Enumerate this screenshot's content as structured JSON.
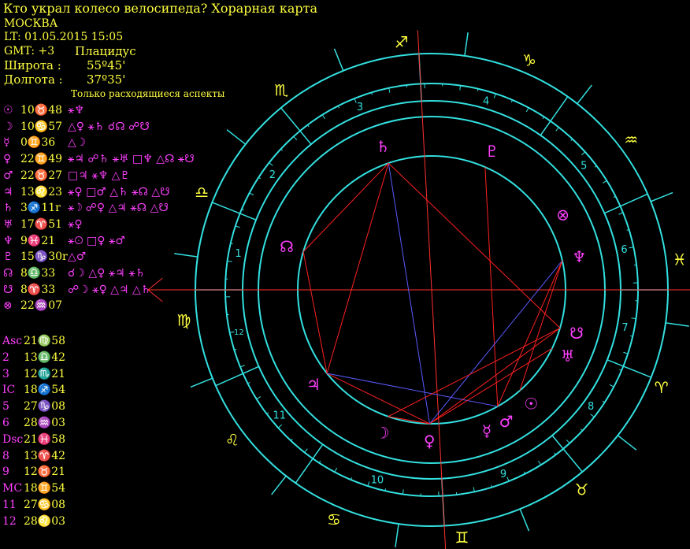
{
  "header": {
    "title": "Кто украл колесо велосипеда? Хорарная карта",
    "city": "МОСКВА",
    "lt": "LT: 01.05.2015  15:05",
    "gmt": "GMT: +3",
    "house_system": "Плацидус",
    "lat_label": "Широта :",
    "lat_value": "55º45'",
    "lon_label": "Долгота :",
    "lon_value": "37º35'",
    "aspect_note": "Только расходящиеся аспекты"
  },
  "planets": [
    {
      "glyph": "☉",
      "pos": "10♉48",
      "aspects": "⚹♆"
    },
    {
      "glyph": "☽",
      "pos": "10♋57",
      "aspects": "△♀ ⚹♄ ☌☊ ☍☋"
    },
    {
      "glyph": "☿",
      "pos": "0♊36",
      "aspects": "△☽"
    },
    {
      "glyph": "♀",
      "pos": "22♊49",
      "aspects": "⚹♃ ☍♄ ⚹♅ □♆ △☊ ⚹☋"
    },
    {
      "glyph": "♂",
      "pos": "22♉27",
      "aspects": "□♃ ⚹♆ △♇"
    },
    {
      "glyph": "♃",
      "pos": "13♌23",
      "aspects": "⚹♀ □♂ △♄ ⚹☊ △☋"
    },
    {
      "glyph": "♄",
      "pos": "3♐11r",
      "aspects": "⚹☽ ☍♀ △♃ ⚹☊ △☋"
    },
    {
      "glyph": "♅",
      "pos": "17♈51",
      "aspects": "⚹♀"
    },
    {
      "glyph": "♆",
      "pos": "9♓21",
      "aspects": "⚹☉ □♀ ⚹♂"
    },
    {
      "glyph": "♇",
      "pos": "15♑30r",
      "aspects": "△♂"
    },
    {
      "glyph": "☊",
      "pos": "8♎33",
      "aspects": "☌☽ △♀ ⚹♃ ⚹♄"
    },
    {
      "glyph": "☋",
      "pos": "8♈33",
      "aspects": "☍☽ ⚹♀ △♃ △♄"
    },
    {
      "glyph": "⊗",
      "pos": "22♒07",
      "aspects": ""
    }
  ],
  "houses": [
    {
      "label": "Asc",
      "pos": "21♍58"
    },
    {
      "label": "2",
      "pos": "13♎42"
    },
    {
      "label": "3",
      "pos": "12♏21"
    },
    {
      "label": "IC",
      "pos": "18♐54"
    },
    {
      "label": "5",
      "pos": "27♑08"
    },
    {
      "label": "6",
      "pos": "28♒03"
    },
    {
      "label": "Dsc",
      "pos": "21♓58"
    },
    {
      "label": "8",
      "pos": "13♈42"
    },
    {
      "label": "9",
      "pos": "12♉21"
    },
    {
      "label": "MC",
      "pos": "18♊54"
    },
    {
      "label": "11",
      "pos": "27♋08"
    },
    {
      "label": "12",
      "pos": "28♌03"
    }
  ],
  "chart": {
    "signs": [
      "♈",
      "♉",
      "♊",
      "♋",
      "♌",
      "♍",
      "♎",
      "♏",
      "♐",
      "♑",
      "♒",
      "♓"
    ],
    "house_numbers": [
      "1",
      "2",
      "3",
      "4",
      "5",
      "6",
      "7",
      "8",
      "9",
      "10",
      "11",
      "12"
    ],
    "colors": {
      "ring": "#33e0e0",
      "text": "#ffff40",
      "glyph": "#ff40ff",
      "axis": "#ff3030",
      "aspect_red": "#ff2020",
      "aspect_blue": "#5a5aff"
    }
  }
}
